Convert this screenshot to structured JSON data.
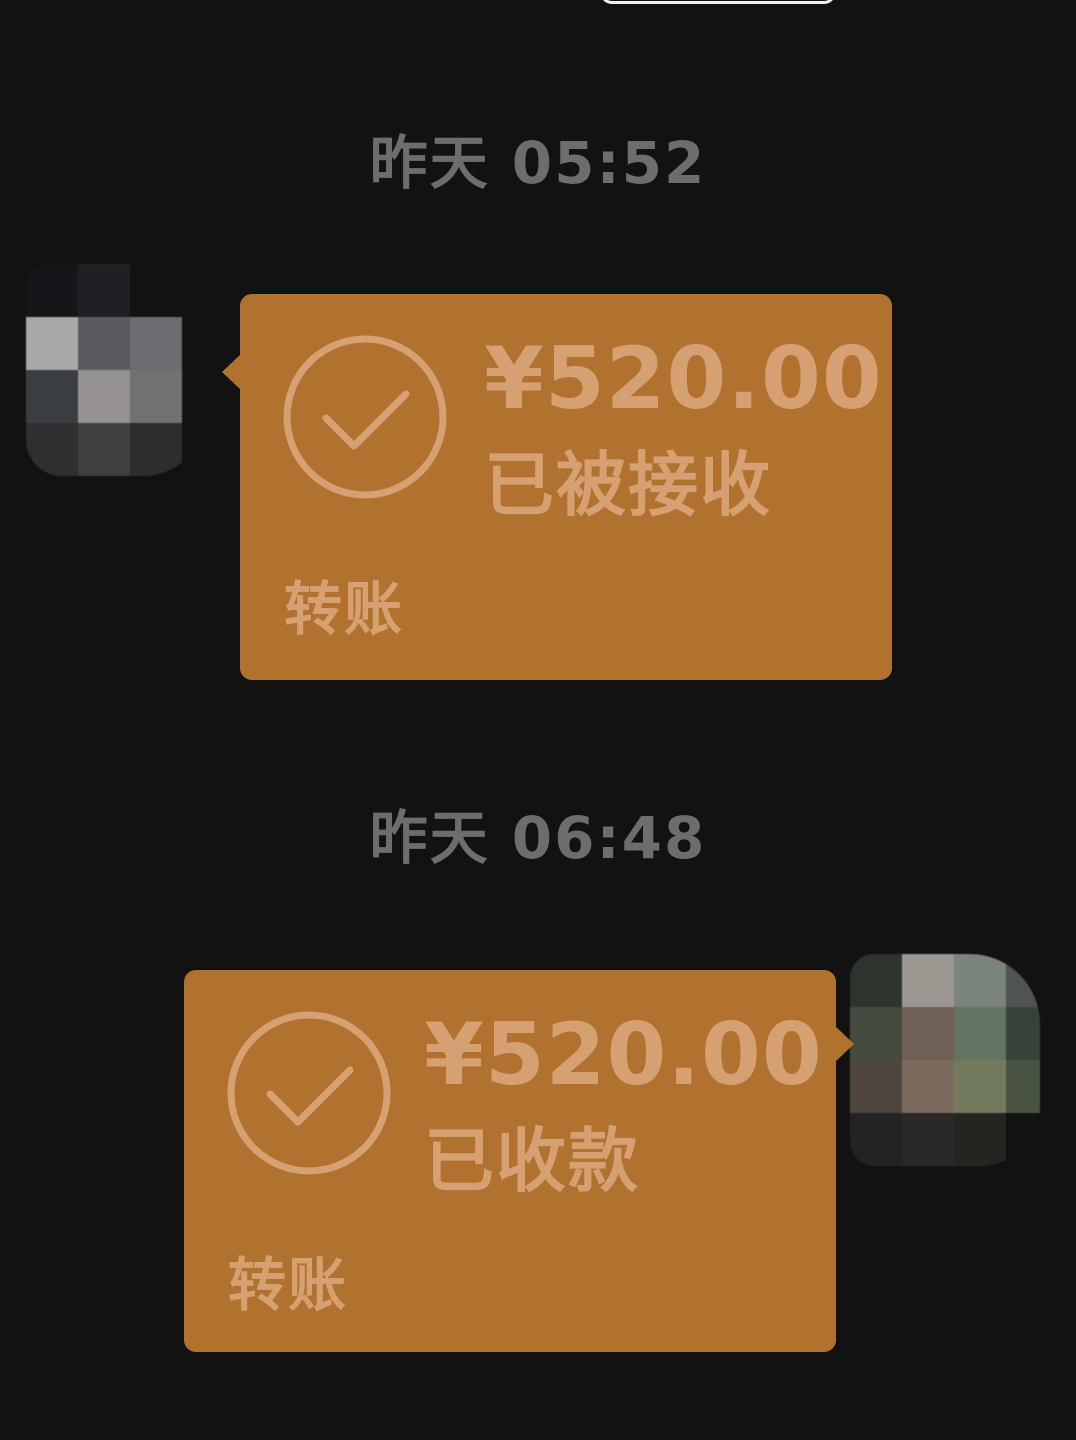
{
  "messages": [
    {
      "timestamp": "昨天 05:52",
      "side": "left",
      "transfer": {
        "amount": "¥520.00",
        "status": "已被接收",
        "label": "转账"
      }
    },
    {
      "timestamp": "昨天 06:48",
      "side": "right",
      "transfer": {
        "amount": "¥520.00",
        "status": "已收款",
        "label": "转账"
      }
    }
  ],
  "icons": {
    "transfer_status": "check-circle-icon",
    "avatar": "pixelated-avatar"
  },
  "colors": {
    "background": "#121212",
    "bubble": "#b0722e",
    "bubble_text": "#d6a172",
    "timestamp_text": "#6d6d6d"
  }
}
